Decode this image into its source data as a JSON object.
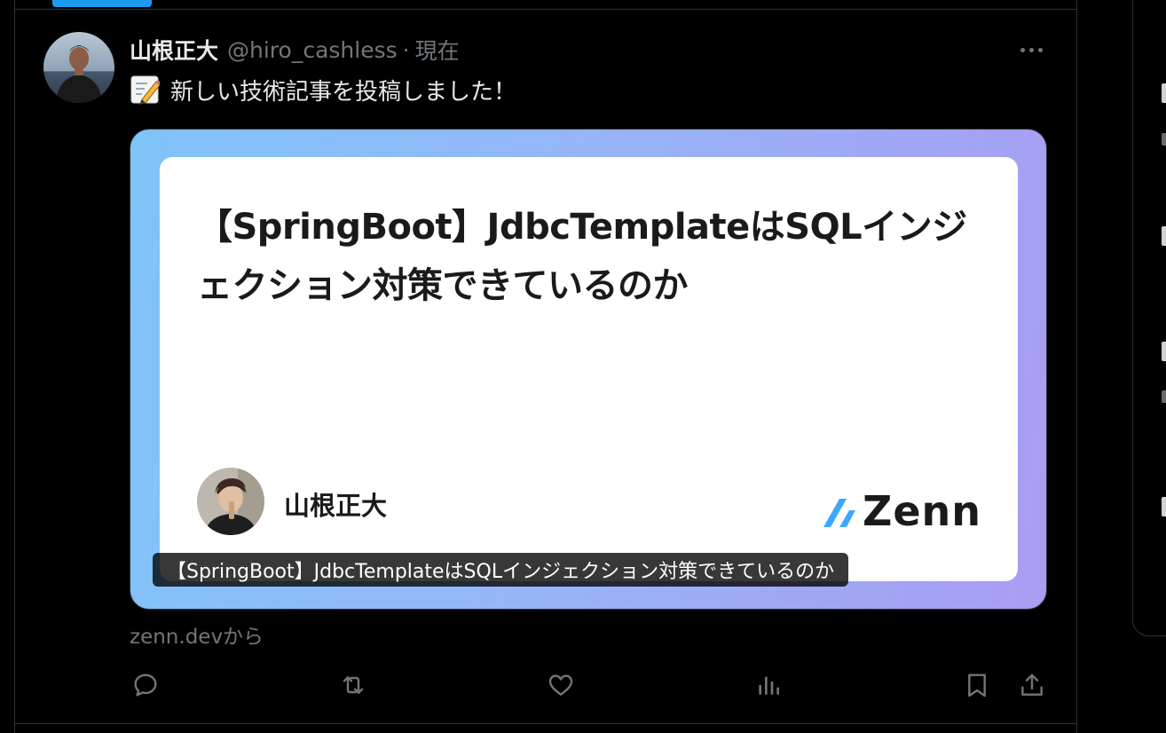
{
  "tweet": {
    "author_name": "山根正大",
    "handle": "@hiro_cashless",
    "separator": "·",
    "timestamp": "現在",
    "text": "新しい技術記事を投稿しました！",
    "text_icon": "memo-icon"
  },
  "link_card": {
    "article_title": "【SpringBoot】JdbcTemplateはSQLインジェクション対策できているのか",
    "author": "山根正大",
    "brand": "Zenn",
    "caption": "【SpringBoot】JdbcTemplateはSQLインジェクション対策できているのか",
    "source": "zenn.devから"
  },
  "actions": [
    {
      "name": "reply-icon"
    },
    {
      "name": "retweet-icon"
    },
    {
      "name": "like-icon"
    },
    {
      "name": "views-icon"
    },
    {
      "name": "bookmark-icon"
    },
    {
      "name": "share-icon"
    }
  ],
  "colors": {
    "background": "#000000",
    "border": "#2f3336",
    "muted_text": "#71767b",
    "primary_text": "#e7e9ea",
    "accent": "#1d9bf0",
    "zenn_blue": "#3ea8ff"
  }
}
